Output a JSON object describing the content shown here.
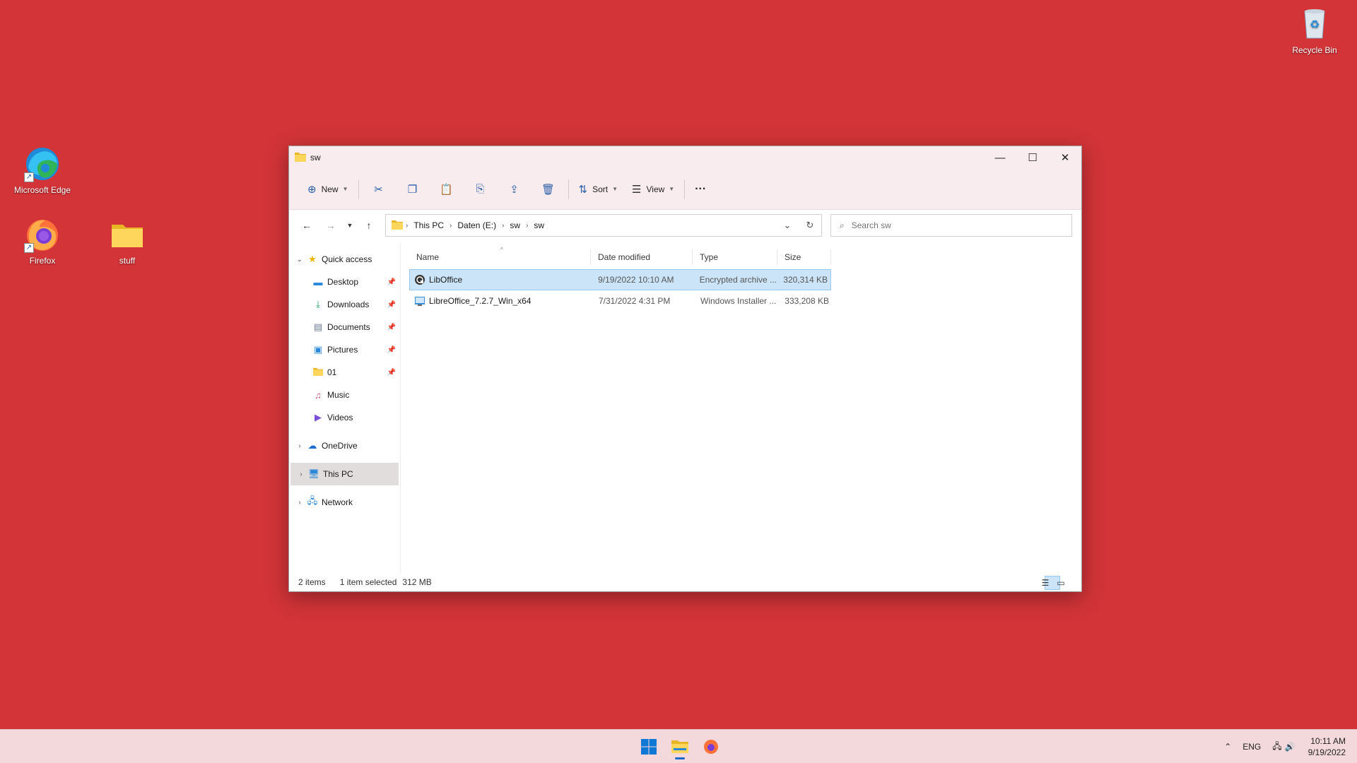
{
  "desktop": {
    "icons": [
      {
        "label": "Microsoft Edge"
      },
      {
        "label": "Firefox"
      },
      {
        "label": "stuff"
      },
      {
        "label": "Recycle Bin"
      }
    ]
  },
  "window": {
    "title": "sw",
    "toolbar": {
      "new_label": "New",
      "sort_label": "Sort",
      "view_label": "View",
      "more_label": "···"
    },
    "address": {
      "crumbs": [
        "This PC",
        "Daten (E:)",
        "sw",
        "sw"
      ]
    },
    "search": {
      "placeholder": "Search sw"
    },
    "nav": {
      "quick_access": "Quick access",
      "items": [
        {
          "label": "Desktop"
        },
        {
          "label": "Downloads"
        },
        {
          "label": "Documents"
        },
        {
          "label": "Pictures"
        },
        {
          "label": "01"
        },
        {
          "label": "Music"
        },
        {
          "label": "Videos"
        }
      ],
      "onedrive": "OneDrive",
      "this_pc": "This PC",
      "network": "Network"
    },
    "columns": {
      "name": "Name",
      "date": "Date modified",
      "type": "Type",
      "size": "Size"
    },
    "files": [
      {
        "name": "LibOffice",
        "date": "9/19/2022 10:10 AM",
        "type": "Encrypted archive ...",
        "size": "320,314 KB"
      },
      {
        "name": "LibreOffice_7.2.7_Win_x64",
        "date": "7/31/2022 4:31 PM",
        "type": "Windows Installer ...",
        "size": "333,208 KB"
      }
    ],
    "status": {
      "count": "2 items",
      "selected": "1 item selected",
      "size": "312 MB"
    }
  },
  "taskbar": {
    "lang": "ENG",
    "time": "10:11 AM",
    "date": "9/19/2022"
  },
  "colors": {
    "desktop_bg": "#d23438",
    "accent": "#1b6ac9",
    "selection": "#cce4f7"
  }
}
